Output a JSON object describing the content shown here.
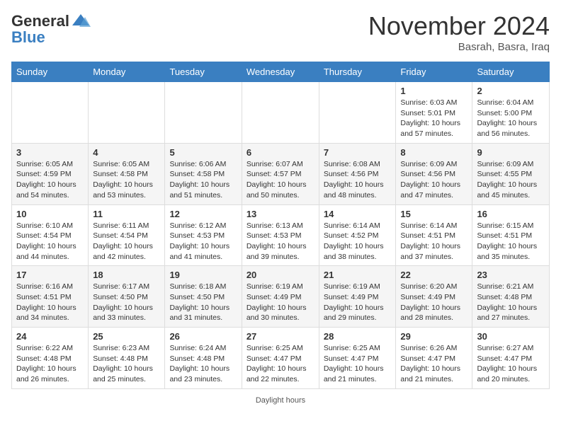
{
  "logo": {
    "general": "General",
    "blue": "Blue"
  },
  "header": {
    "month": "November 2024",
    "location": "Basrah, Basra, Iraq"
  },
  "days_of_week": [
    "Sunday",
    "Monday",
    "Tuesday",
    "Wednesday",
    "Thursday",
    "Friday",
    "Saturday"
  ],
  "weeks": [
    [
      {
        "day": "",
        "info": ""
      },
      {
        "day": "",
        "info": ""
      },
      {
        "day": "",
        "info": ""
      },
      {
        "day": "",
        "info": ""
      },
      {
        "day": "",
        "info": ""
      },
      {
        "day": "1",
        "info": "Sunrise: 6:03 AM\nSunset: 5:01 PM\nDaylight: 10 hours and 57 minutes."
      },
      {
        "day": "2",
        "info": "Sunrise: 6:04 AM\nSunset: 5:00 PM\nDaylight: 10 hours and 56 minutes."
      }
    ],
    [
      {
        "day": "3",
        "info": "Sunrise: 6:05 AM\nSunset: 4:59 PM\nDaylight: 10 hours and 54 minutes."
      },
      {
        "day": "4",
        "info": "Sunrise: 6:05 AM\nSunset: 4:58 PM\nDaylight: 10 hours and 53 minutes."
      },
      {
        "day": "5",
        "info": "Sunrise: 6:06 AM\nSunset: 4:58 PM\nDaylight: 10 hours and 51 minutes."
      },
      {
        "day": "6",
        "info": "Sunrise: 6:07 AM\nSunset: 4:57 PM\nDaylight: 10 hours and 50 minutes."
      },
      {
        "day": "7",
        "info": "Sunrise: 6:08 AM\nSunset: 4:56 PM\nDaylight: 10 hours and 48 minutes."
      },
      {
        "day": "8",
        "info": "Sunrise: 6:09 AM\nSunset: 4:56 PM\nDaylight: 10 hours and 47 minutes."
      },
      {
        "day": "9",
        "info": "Sunrise: 6:09 AM\nSunset: 4:55 PM\nDaylight: 10 hours and 45 minutes."
      }
    ],
    [
      {
        "day": "10",
        "info": "Sunrise: 6:10 AM\nSunset: 4:54 PM\nDaylight: 10 hours and 44 minutes."
      },
      {
        "day": "11",
        "info": "Sunrise: 6:11 AM\nSunset: 4:54 PM\nDaylight: 10 hours and 42 minutes."
      },
      {
        "day": "12",
        "info": "Sunrise: 6:12 AM\nSunset: 4:53 PM\nDaylight: 10 hours and 41 minutes."
      },
      {
        "day": "13",
        "info": "Sunrise: 6:13 AM\nSunset: 4:53 PM\nDaylight: 10 hours and 39 minutes."
      },
      {
        "day": "14",
        "info": "Sunrise: 6:14 AM\nSunset: 4:52 PM\nDaylight: 10 hours and 38 minutes."
      },
      {
        "day": "15",
        "info": "Sunrise: 6:14 AM\nSunset: 4:51 PM\nDaylight: 10 hours and 37 minutes."
      },
      {
        "day": "16",
        "info": "Sunrise: 6:15 AM\nSunset: 4:51 PM\nDaylight: 10 hours and 35 minutes."
      }
    ],
    [
      {
        "day": "17",
        "info": "Sunrise: 6:16 AM\nSunset: 4:51 PM\nDaylight: 10 hours and 34 minutes."
      },
      {
        "day": "18",
        "info": "Sunrise: 6:17 AM\nSunset: 4:50 PM\nDaylight: 10 hours and 33 minutes."
      },
      {
        "day": "19",
        "info": "Sunrise: 6:18 AM\nSunset: 4:50 PM\nDaylight: 10 hours and 31 minutes."
      },
      {
        "day": "20",
        "info": "Sunrise: 6:19 AM\nSunset: 4:49 PM\nDaylight: 10 hours and 30 minutes."
      },
      {
        "day": "21",
        "info": "Sunrise: 6:19 AM\nSunset: 4:49 PM\nDaylight: 10 hours and 29 minutes."
      },
      {
        "day": "22",
        "info": "Sunrise: 6:20 AM\nSunset: 4:49 PM\nDaylight: 10 hours and 28 minutes."
      },
      {
        "day": "23",
        "info": "Sunrise: 6:21 AM\nSunset: 4:48 PM\nDaylight: 10 hours and 27 minutes."
      }
    ],
    [
      {
        "day": "24",
        "info": "Sunrise: 6:22 AM\nSunset: 4:48 PM\nDaylight: 10 hours and 26 minutes."
      },
      {
        "day": "25",
        "info": "Sunrise: 6:23 AM\nSunset: 4:48 PM\nDaylight: 10 hours and 25 minutes."
      },
      {
        "day": "26",
        "info": "Sunrise: 6:24 AM\nSunset: 4:48 PM\nDaylight: 10 hours and 23 minutes."
      },
      {
        "day": "27",
        "info": "Sunrise: 6:25 AM\nSunset: 4:47 PM\nDaylight: 10 hours and 22 minutes."
      },
      {
        "day": "28",
        "info": "Sunrise: 6:25 AM\nSunset: 4:47 PM\nDaylight: 10 hours and 21 minutes."
      },
      {
        "day": "29",
        "info": "Sunrise: 6:26 AM\nSunset: 4:47 PM\nDaylight: 10 hours and 21 minutes."
      },
      {
        "day": "30",
        "info": "Sunrise: 6:27 AM\nSunset: 4:47 PM\nDaylight: 10 hours and 20 minutes."
      }
    ]
  ],
  "footer": {
    "label": "Daylight hours"
  }
}
